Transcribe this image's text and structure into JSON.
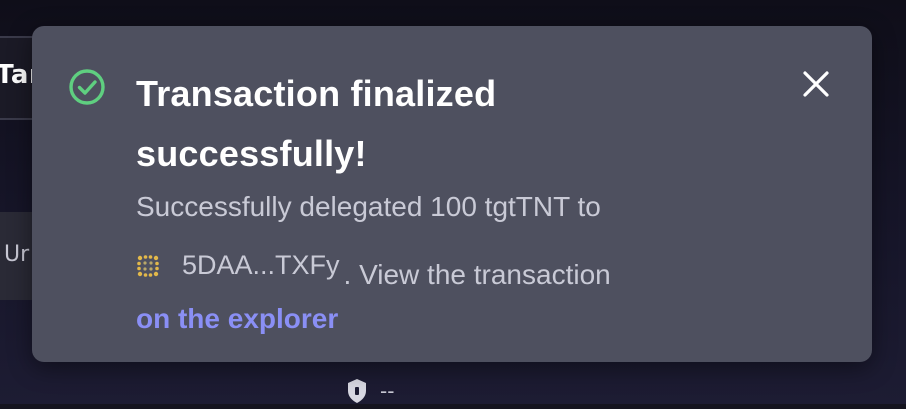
{
  "background": {
    "top_card_label": "Tar",
    "mid_card_label": "Ur",
    "bottom_value": "--"
  },
  "toast": {
    "status": "success",
    "icon": "check-circle-icon",
    "title": "Transaction finalized successfully!",
    "message_prefix": "Successfully delegated 100 tgtTNT to",
    "address": "5DAA...TXFy",
    "message_suffix": ". View the transaction",
    "link_label": "on the explorer",
    "close_icon": "close-icon",
    "colors": {
      "background": "#4e505f",
      "success": "#5fcf80",
      "link": "#8a8ff5"
    }
  }
}
